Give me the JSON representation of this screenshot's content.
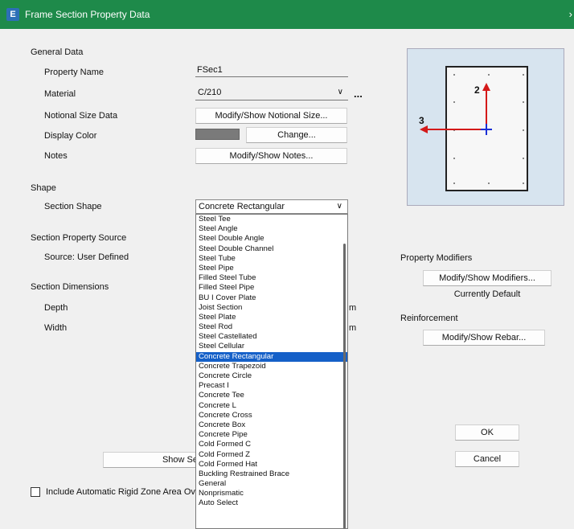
{
  "window": {
    "title": "Frame Section Property Data",
    "app_icon": "E"
  },
  "general": {
    "title": "General Data",
    "property_name_label": "Property Name",
    "property_name_value": "FSec1",
    "material_label": "Material",
    "material_value": "C/210",
    "material_more": "...",
    "notional_label": "Notional Size Data",
    "notional_button": "Modify/Show Notional Size...",
    "display_color_label": "Display Color",
    "display_color_swatch": "#7a7a7a",
    "change_button": "Change...",
    "notes_label": "Notes",
    "notes_button": "Modify/Show Notes..."
  },
  "shape": {
    "title": "Shape",
    "section_shape_label": "Section Shape",
    "section_shape_value": "Concrete Rectangular",
    "options": [
      "Steel Tee",
      "Steel Angle",
      "Steel Double Angle",
      "Steel Double Channel",
      "Steel Tube",
      "Steel Pipe",
      "Filled Steel Tube",
      "Filled Steel Pipe",
      "BU I Cover Plate",
      "Joist Section",
      "Steel Plate",
      "Steel Rod",
      "Steel Castellated",
      "Steel Cellular",
      "Concrete Rectangular",
      "Concrete Trapezoid",
      "Concrete Circle",
      "Precast I",
      "Concrete Tee",
      "Concrete L",
      "Concrete Cross",
      "Concrete Box",
      "Concrete Pipe",
      "Cold Formed C",
      "Cold Formed Z",
      "Cold Formed Hat",
      "Buckling Restrained Brace",
      "General",
      "Nonprismatic",
      "Auto Select"
    ],
    "selected_index": 14
  },
  "source": {
    "title": "Section Property Source",
    "source_text": "Source:  User Defined"
  },
  "dimensions": {
    "title": "Section Dimensions",
    "depth_label": "Depth",
    "width_label": "Width",
    "depth_unit": "m",
    "width_unit": "m"
  },
  "bottom": {
    "show_button_partial": "Show Se",
    "checkbox_label": "Include Automatic Rigid Zone Area Ove"
  },
  "preview": {
    "axis2": "2",
    "axis3": "3"
  },
  "modifiers": {
    "title": "Property Modifiers",
    "button": "Modify/Show Modifiers...",
    "status": "Currently Default"
  },
  "reinforcement": {
    "title": "Reinforcement",
    "button": "Modify/Show Rebar..."
  },
  "actions": {
    "ok": "OK",
    "cancel": "Cancel"
  },
  "colors": {
    "titlebar": "#1e8a4a",
    "selection": "#1560c8",
    "axis_red": "#d41919",
    "axis_blue": "#1a2fd6"
  }
}
